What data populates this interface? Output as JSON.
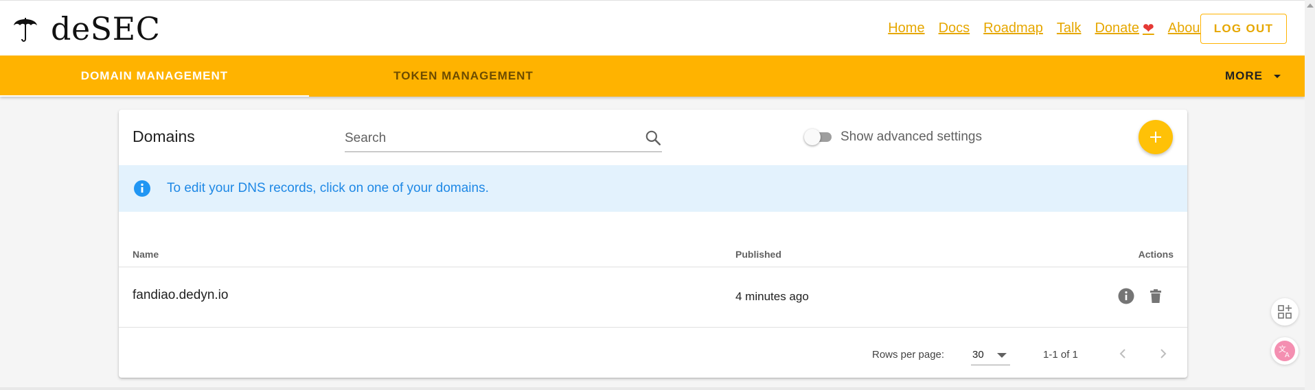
{
  "header": {
    "logo_text": "deSEC",
    "nav": [
      {
        "label": "Home"
      },
      {
        "label": "Docs"
      },
      {
        "label": "Roadmap"
      },
      {
        "label": "Talk"
      },
      {
        "label": "Donate"
      },
      {
        "label": "About"
      }
    ],
    "logout_label": "LOG OUT"
  },
  "tabs": {
    "domain_management": "DOMAIN MANAGEMENT",
    "token_management": "TOKEN MANAGEMENT",
    "more": "MORE"
  },
  "domains": {
    "title": "Domains",
    "search_placeholder": "Search",
    "advanced_toggle_label": "Show advanced settings",
    "advanced_toggle_on": false,
    "info_text": "To edit your DNS records, click on one of your domains.",
    "columns": {
      "name": "Name",
      "published": "Published",
      "actions": "Actions"
    },
    "rows": [
      {
        "name": "fandiao.dedyn.io",
        "published": "4 minutes ago"
      }
    ],
    "footer": {
      "rows_per_page_label": "Rows per page:",
      "rows_per_page_value": "30",
      "range": "1-1 of 1"
    }
  },
  "icons": {
    "logo": "umbrella-icon",
    "donate": "heart-icon",
    "search": "search-icon",
    "add": "plus-icon",
    "info": "info-icon",
    "delete": "trash-icon",
    "prev": "chevron-left-icon",
    "next": "chevron-right-icon"
  },
  "colors": {
    "brand": "#ffb300",
    "link": "#e6a700",
    "info_bg": "#e3f2fd",
    "info_text": "#1e88e5",
    "heart": "#e53935"
  }
}
